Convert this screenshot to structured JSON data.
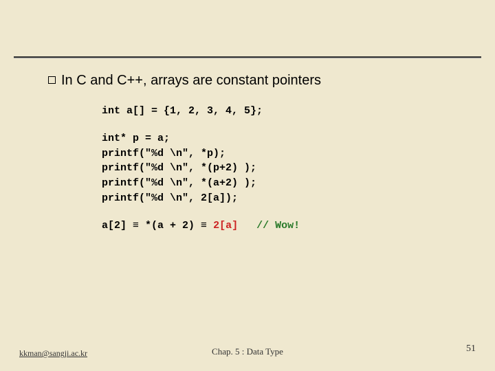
{
  "bullet": "In C and C++, arrays are constant pointers",
  "code": {
    "decl": "int a[] = {1, 2, 3, 4, 5};",
    "block2": "int* p = a;\nprintf(\"%d \\n\", *p);\nprintf(\"%d \\n\", *(p+2) );\nprintf(\"%d \\n\", *(a+2) );\nprintf(\"%d \\n\", 2[a]);",
    "eq_lhs": "a[2]",
    "eq_sym1": " ≡ ",
    "eq_mid": "*(a + 2)",
    "eq_sym2": " ≡ ",
    "eq_rhs": "2[a]",
    "comment": "// Wow!"
  },
  "footer": {
    "email": "kkman@sangji.ac.kr",
    "chapter": "Chap. 5 : Data Type",
    "page": "51"
  }
}
